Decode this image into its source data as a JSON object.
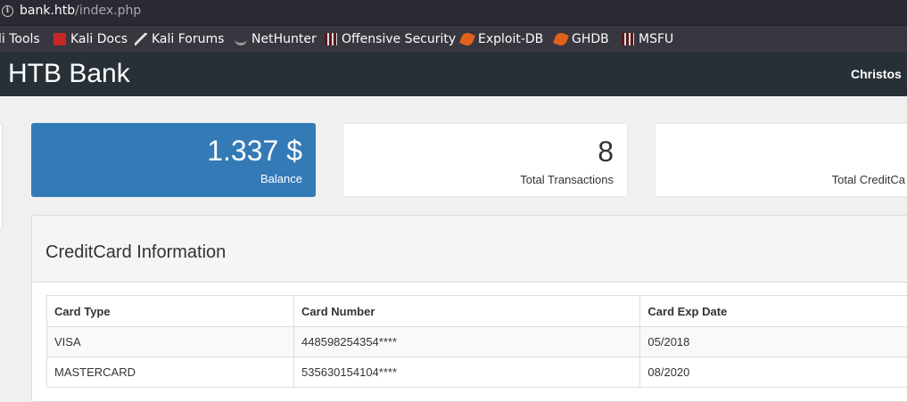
{
  "browser": {
    "url_host": "bank.htb",
    "url_path": "/index.php",
    "bookmarks": [
      {
        "label": "li Tools",
        "icon": "kali-tools-icon"
      },
      {
        "label": "Kali Docs",
        "icon": "kali-docs-icon"
      },
      {
        "label": "Kali Forums",
        "icon": "kali-forums-icon"
      },
      {
        "label": "NetHunter",
        "icon": "nethunter-icon"
      },
      {
        "label": "Offensive Security",
        "icon": "offensive-security-icon"
      },
      {
        "label": "Exploit-DB",
        "icon": "exploit-db-icon"
      },
      {
        "label": "GHDB",
        "icon": "ghdb-icon"
      },
      {
        "label": "MSFU",
        "icon": "msfu-icon"
      }
    ]
  },
  "navbar": {
    "brand": "HTB Bank",
    "user": "Christos"
  },
  "tiles": {
    "balance": {
      "value": "1.337 $",
      "label": "Balance"
    },
    "transactions": {
      "value": "8",
      "label": "Total Transactions"
    },
    "creditcards": {
      "value": "",
      "label": "Total CreditCa"
    }
  },
  "creditcards": {
    "title": "CreditCard Information",
    "columns": [
      "Card Type",
      "Card Number",
      "Card Exp Date"
    ],
    "rows": [
      [
        "VISA",
        "448598254354****",
        "05/2018"
      ],
      [
        "MASTERCARD",
        "535630154104****",
        "08/2020"
      ]
    ]
  },
  "colors": {
    "navbar": "#283037",
    "balance_tile": "#337ab7",
    "page_bg": "#f0f0f0"
  }
}
